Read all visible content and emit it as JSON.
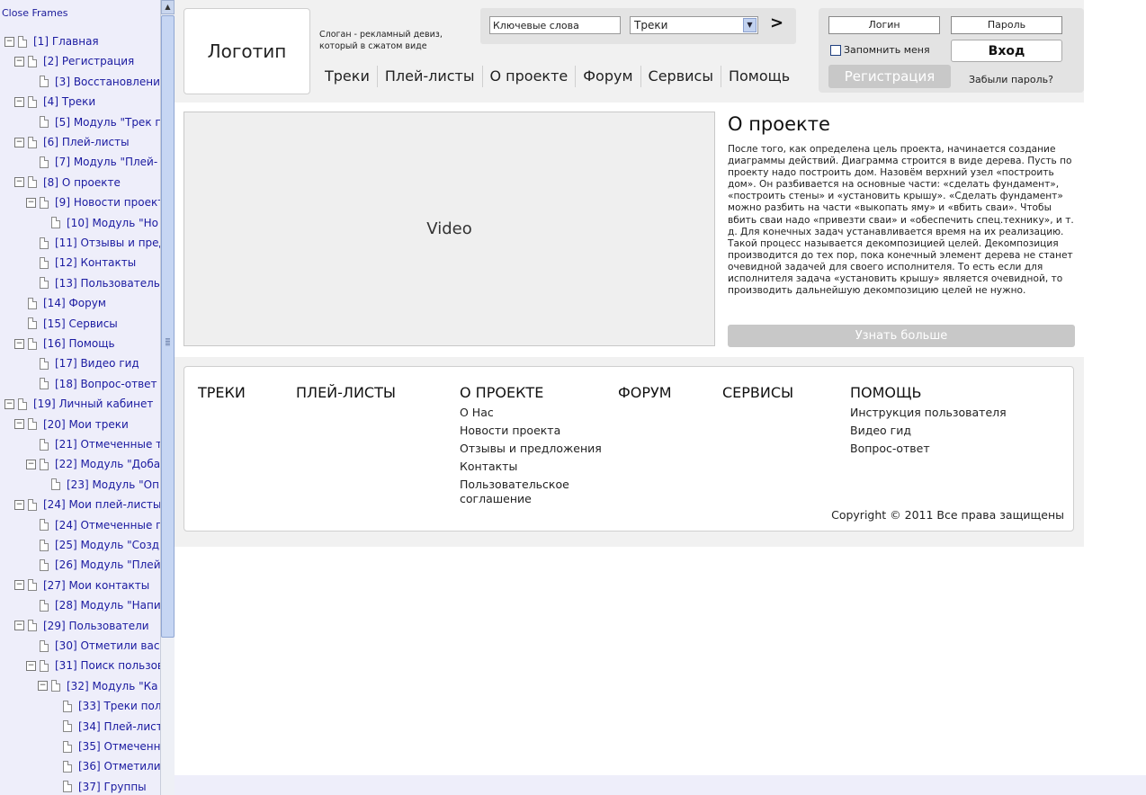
{
  "left_frame": {
    "close_frames": "Close Frames",
    "tree": [
      {
        "label": "[1] Главная",
        "toggle": "⊟",
        "level": 0
      },
      {
        "label": "[2] Регистрация",
        "toggle": "⊟",
        "level": 1
      },
      {
        "label": "[3] Восстановлени",
        "toggle": "",
        "level": 2
      },
      {
        "label": "[4] Треки",
        "toggle": "⊟",
        "level": 1
      },
      {
        "label": "[5] Модуль \"Трек г",
        "toggle": "",
        "level": 2
      },
      {
        "label": "[6] Плей-листы",
        "toggle": "⊟",
        "level": 1
      },
      {
        "label": "[7] Модуль \"Плей-",
        "toggle": "",
        "level": 2
      },
      {
        "label": "[8] О проекте",
        "toggle": "⊟",
        "level": 1
      },
      {
        "label": "[9] Новости проект",
        "toggle": "⊟",
        "level": 2
      },
      {
        "label": "[10] Модуль \"Но",
        "toggle": "",
        "level": 3
      },
      {
        "label": "[11] Отзывы и пред",
        "toggle": "",
        "level": 2
      },
      {
        "label": "[12] Контакты",
        "toggle": "",
        "level": 2
      },
      {
        "label": "[13] Пользователь",
        "toggle": "",
        "level": 2
      },
      {
        "label": "[14] Форум",
        "toggle": "",
        "level": 1
      },
      {
        "label": "[15] Сервисы",
        "toggle": "",
        "level": 1
      },
      {
        "label": "[16] Помощь",
        "toggle": "⊟",
        "level": 1
      },
      {
        "label": "[17] Видео гид",
        "toggle": "",
        "level": 2
      },
      {
        "label": "[18] Вопрос-ответ",
        "toggle": "",
        "level": 2
      },
      {
        "label": "[19] Личный кабинет",
        "toggle": "⊟",
        "level": 0
      },
      {
        "label": "[20] Мои треки",
        "toggle": "⊟",
        "level": 1
      },
      {
        "label": "[21] Отмеченные т",
        "toggle": "",
        "level": 2
      },
      {
        "label": "[22] Модуль \"Доба",
        "toggle": "⊟",
        "level": 2
      },
      {
        "label": "[23] Модуль \"Оп",
        "toggle": "",
        "level": 3
      },
      {
        "label": "[24] Мои плей-листы",
        "toggle": "⊟",
        "level": 1
      },
      {
        "label": "[24] Отмеченные п",
        "toggle": "",
        "level": 2
      },
      {
        "label": "[25] Модуль \"Созд",
        "toggle": "",
        "level": 2
      },
      {
        "label": "[26] Модуль \"Плей",
        "toggle": "",
        "level": 2
      },
      {
        "label": "[27] Мои контакты",
        "toggle": "⊟",
        "level": 1
      },
      {
        "label": "[28] Модуль \"Напи",
        "toggle": "",
        "level": 2
      },
      {
        "label": "[29] Пользователи",
        "toggle": "⊟",
        "level": 1
      },
      {
        "label": "[30] Отметили вас",
        "toggle": "",
        "level": 2
      },
      {
        "label": "[31] Поиск пользов",
        "toggle": "⊟",
        "level": 2
      },
      {
        "label": "[32] Модуль \"Ка",
        "toggle": "⊟",
        "level": 3
      },
      {
        "label": "[33] Треки пол",
        "toggle": "",
        "level": 4
      },
      {
        "label": "[34] Плей-лист",
        "toggle": "",
        "level": 4
      },
      {
        "label": "[35] Отмеченн",
        "toggle": "",
        "level": 4
      },
      {
        "label": "[36] Отметили",
        "toggle": "",
        "level": 4
      },
      {
        "label": "[37] Группы",
        "toggle": "",
        "level": 4
      }
    ]
  },
  "header": {
    "logo": "Логотип",
    "slogan": "Слоган - рекламный девиз, который в сжатом виде",
    "search": {
      "keywords": "Ключевые слова",
      "select_value": "Треки",
      "go": ">"
    },
    "nav": [
      "Треки",
      "Плей-листы",
      "О проекте",
      "Форум",
      "Сервисы",
      "Помощь"
    ],
    "login": {
      "login_field": "Логин",
      "password_field": "Пароль",
      "remember": "Запомнить меня",
      "enter": "Вход",
      "register": "Регистрация",
      "forgot": "Забыли пароль?"
    }
  },
  "content": {
    "video": "Video",
    "about_title": "О проекте",
    "about_text": "После того, как определена цель проекта, начинается создание диаграммы действий. Диаграмма строится в виде дерева. Пусть по проекту надо построить дом. Назовём верхний узел «построить дом». Он разбивается на основные части: «сделать фундамент», «построить стены» и «установить крышу». «Сделать фундамент» можно разбить на части «выкопать яму» и «вбить сваи». Чтобы вбить сваи надо «привезти сваи» и «обеспечить спец.технику», и т. д. Для конечных задач устанавливается время на их реализацию. Такой процесс называется декомпозицией целей. Декомпозиция производится до тех пор, пока конечный элемент дерева не станет очевидной задачей для своего исполнителя. То есть если для исполнителя задача «установить крышу» является очевидной, то производить дальнейшую декомпозицию целей не нужно.",
    "more_button": "Узнать больше"
  },
  "footer": {
    "columns": [
      {
        "title": "ТРЕКИ",
        "links": []
      },
      {
        "title": "ПЛЕЙ-ЛИСТЫ",
        "links": []
      },
      {
        "title": "О ПРОЕКТЕ",
        "links": [
          "О Нас",
          "Новости проекта",
          "Отзывы и предложения",
          "Контакты",
          "Пользовательское соглашение"
        ]
      },
      {
        "title": "ФОРУМ",
        "links": []
      },
      {
        "title": "СЕРВИСЫ",
        "links": []
      },
      {
        "title": "ПОМОЩЬ",
        "links": [
          "Инструкция пользователя",
          "Видео гид",
          "Вопрос-ответ"
        ]
      }
    ],
    "copyright": "Copyright © 2011 Все права защищены"
  },
  "icons": {
    "tree_toggle": "minus-box-icon",
    "tree_node": "document-icon",
    "scroll_up": "arrow-up-icon",
    "select_arrow": "chevron-down-icon"
  }
}
